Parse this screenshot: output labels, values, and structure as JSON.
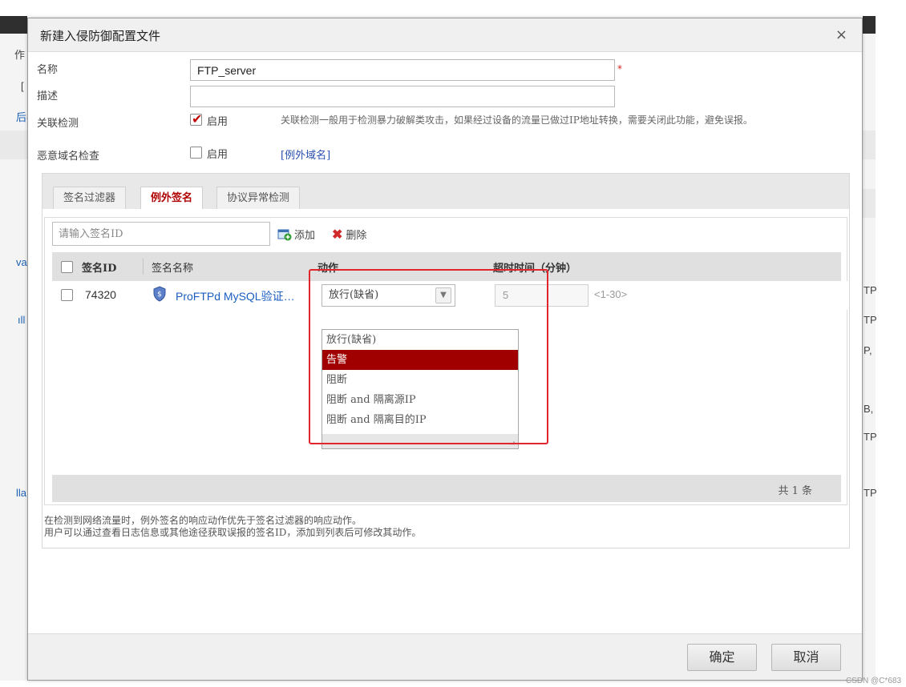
{
  "dialog": {
    "title": "新建入侵防御配置文件",
    "close": "×"
  },
  "form": {
    "name_label": "名称",
    "name_value": "FTP_server",
    "required_mark": "*",
    "desc_label": "描述",
    "desc_value": "",
    "correlation_label": "关联检测",
    "correlation_checked": true,
    "correlation_enable": "启用",
    "correlation_hint": "关联检测一般用于检测暴力破解类攻击，如果经过设备的流量已做过IP地址转换，需要关闭此功能，避免误报。",
    "malicious_label": "恶意域名检查",
    "malicious_checked": false,
    "malicious_enable": "启用",
    "exception_domain_link": "[例外域名]"
  },
  "tabs": [
    {
      "label": "签名过滤器",
      "active": false
    },
    {
      "label": "例外签名",
      "active": true
    },
    {
      "label": "协议异常检测",
      "active": false
    }
  ],
  "toolbar": {
    "search_placeholder": "请输入签名ID",
    "add_label": "添加",
    "delete_label": "删除"
  },
  "grid": {
    "columns": [
      "签名ID",
      "签名名称",
      "动作",
      "超时时间（分钟）"
    ],
    "rows": [
      {
        "id": "74320",
        "name": "ProFTPd MySQL验证…",
        "action": "放行(缺省)",
        "timeout": "5",
        "range": "<1-30>"
      }
    ],
    "total": "共 1 条"
  },
  "action_dropdown": {
    "options": [
      "放行(缺省)",
      "告警",
      "阻断",
      "阻断 and 隔离源IP",
      "阻断 and 隔离目的IP"
    ],
    "highlighted": "告警"
  },
  "notes": [
    "在检测到网络流量时，例外签名的响应动作优先于签名过滤器的响应动作。",
    "用户可以通过查看日志信息或其他途径获取误报的签名ID，添加到列表后可修改其动作。"
  ],
  "buttons": {
    "ok": "确定",
    "cancel": "取消"
  },
  "background_fragments": {
    "left": [
      "作",
      "[",
      "后(",
      "va",
      "ıll",
      "lla"
    ],
    "right": [
      "TP",
      "TP",
      "P,",
      "B,",
      "TP",
      "TP"
    ]
  },
  "watermark": "CSDN @C*683",
  "colors": {
    "accent": "#a00000",
    "link": "#1b5ec0",
    "highlight_box": "#e0262a"
  }
}
